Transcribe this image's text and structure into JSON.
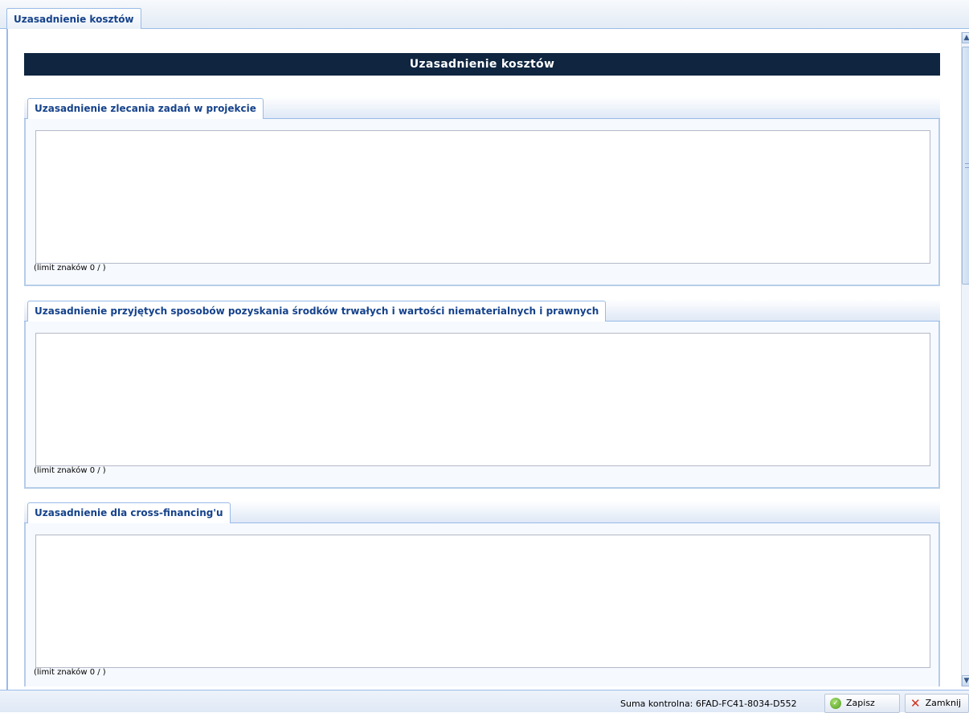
{
  "top_tab": {
    "label": "Uzasadnienie kosztów"
  },
  "form": {
    "header": "Uzasadnienie kosztów",
    "sections": [
      {
        "title": "Uzasadnienie zlecania zadań w projekcie",
        "value": "",
        "limit_text": "(limit znaków 0 / )"
      },
      {
        "title": "Uzasadnienie przyjętych sposobów pozyskania środków trwałych i wartości niematerialnych i prawnych",
        "value": "",
        "limit_text": "(limit znaków 0 / )"
      },
      {
        "title": "Uzasadnienie dla cross-financing'u",
        "value": "",
        "limit_text": "(limit znaków 0 / )"
      }
    ]
  },
  "scrollbar": {
    "up_arrow": "▲",
    "down_arrow": "▼"
  },
  "footer": {
    "checksum": "Suma kontrolna: 6FAD-FC41-8034-D552",
    "save_label": "Zapisz",
    "close_label": "Zamknij",
    "save_icon": "check-circle-icon",
    "close_icon": "red-x-icon"
  }
}
